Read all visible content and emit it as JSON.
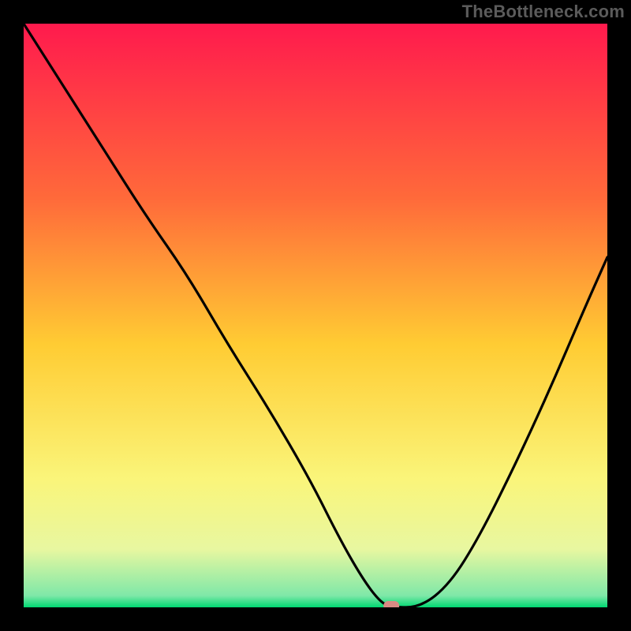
{
  "watermark": "TheBottleneck.com",
  "colors": {
    "frame": "#000000",
    "watermark_text": "#5b5b5b",
    "gradient_top": "#ff1a4d",
    "gradient_mid_upper": "#ff6a3a",
    "gradient_mid": "#ffcc33",
    "gradient_mid_lower": "#faf57a",
    "gradient_lower": "#e8f7a0",
    "gradient_green": "#00d872",
    "curve_stroke": "#000000",
    "marker_fill": "#d98b84"
  },
  "chart_data": {
    "type": "line",
    "title": "",
    "xlabel": "",
    "ylabel": "",
    "xlim": [
      0,
      100
    ],
    "ylim": [
      0,
      100
    ],
    "grid": false,
    "legend": false,
    "series": [
      {
        "name": "bottleneck-curve",
        "x": [
          0,
          7,
          14,
          21,
          28,
          35,
          42,
          49,
          54,
          58,
          61,
          63,
          68,
          73,
          78,
          84,
          90,
          96,
          100
        ],
        "y": [
          100,
          89,
          78,
          67,
          57,
          45,
          34,
          22,
          12,
          5,
          1,
          0,
          0,
          4,
          12,
          24,
          37,
          51,
          60
        ]
      }
    ],
    "annotations": [
      {
        "name": "optimal-marker",
        "x": 63,
        "y": 0,
        "shape": "rounded-rect"
      }
    ]
  }
}
